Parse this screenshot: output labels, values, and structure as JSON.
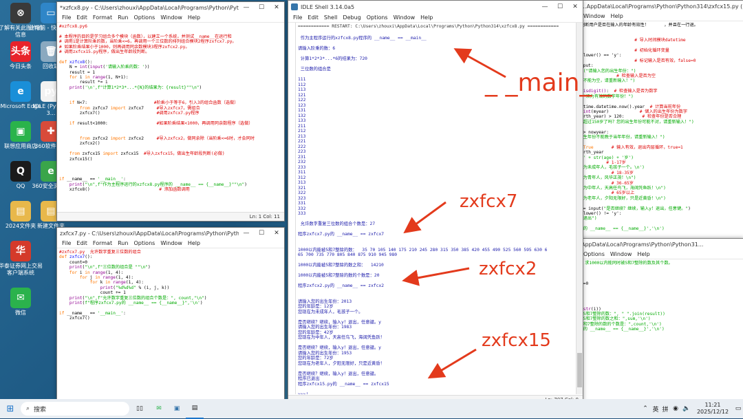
{
  "desktop": {
    "icons": [
      {
        "label": "了解有关此图片的信息",
        "glyph": "⊗",
        "color": "#3a3a3a"
      },
      {
        "label": "此电脑 - 快捷方式",
        "glyph": "▭",
        "color": "#2f86c8"
      },
      {
        "label": "今日头条",
        "glyph": "头条",
        "color": "#e8232b"
      },
      {
        "label": "回收站",
        "glyph": "🗑",
        "color": "#8aa9c0"
      },
      {
        "label": "Microsoft Edge",
        "glyph": "e",
        "color": "#1a8fd8"
      },
      {
        "label": "IDLE (Python 3...",
        "glyph": "py",
        "color": "#f2f2f2"
      },
      {
        "label": "联想应用商店",
        "glyph": "▣",
        "color": "#2ab34b"
      },
      {
        "label": "360软件管家",
        "glyph": "✚",
        "color": "#d84b3a"
      },
      {
        "label": "QQ",
        "glyph": "Q",
        "color": "#1b1b1b"
      },
      {
        "label": "360安全浏览器",
        "glyph": "e",
        "color": "#3aa54a"
      },
      {
        "label": "2024文件夹",
        "glyph": "▤",
        "color": "#e8b84b"
      },
      {
        "label": "新建文件夹",
        "glyph": "▤",
        "color": "#e8b84b"
      },
      {
        "label": "华泰证券网上交易客户端系统",
        "glyph": "华",
        "color": "#d43a2a"
      },
      {
        "label": "微信",
        "glyph": "✉",
        "color": "#2bb24c"
      }
    ]
  },
  "win_xzfcx8": {
    "title": "*xzfcx8.py - C:\\Users\\zhouxi\\AppData\\Local\\Programs\\Python\\Python3...",
    "menu": [
      "File",
      "Edit",
      "Format",
      "Run",
      "Options",
      "Window",
      "Help"
    ],
    "status": "Ln: 1   Col: 11"
  },
  "win_zxfcx7": {
    "title": "zxfcx7.py - C:\\Users\\zhouxi\\AppData\\Local\\Programs\\Python\\Python31...",
    "menu": [
      "File",
      "Edit",
      "Format",
      "Run",
      "Options",
      "Window",
      "Help"
    ]
  },
  "shell": {
    "title": "IDLE Shell 3.14.0a5",
    "menu": [
      "File",
      "Edit",
      "Shell",
      "Debug",
      "Options",
      "Window",
      "Help"
    ],
    "restart_line": "============ RESTART: C:\\Users\\zhouxi\\AppData\\Local\\Programs\\Python\\Python314\\xzfcx8.py ============",
    "status": "Ln: 707   Col: 0"
  },
  "right_window": {
    "title": "...AppData\\Local\\Programs\\Python\\Python314\\zxfcx15.py (3.14.0...",
    "menu": [
      "Window",
      "Help"
    ],
    "title2": "AppData\\Local\\Programs\\Python\\Python31...",
    "menu2": [
      "Options",
      "Window",
      "Help"
    ]
  },
  "annotations": {
    "main": "_ _main_ _",
    "zxfcx7": "zxfcx7",
    "zxfcx2": "zxfcx2",
    "zxfcx15": "zxfcx15",
    "color": "#e33a1c"
  },
  "taskbar": {
    "search": "搜索",
    "time": "11:21",
    "date": "2025/12/12",
    "ime": "英",
    "ime2": "拼"
  }
}
